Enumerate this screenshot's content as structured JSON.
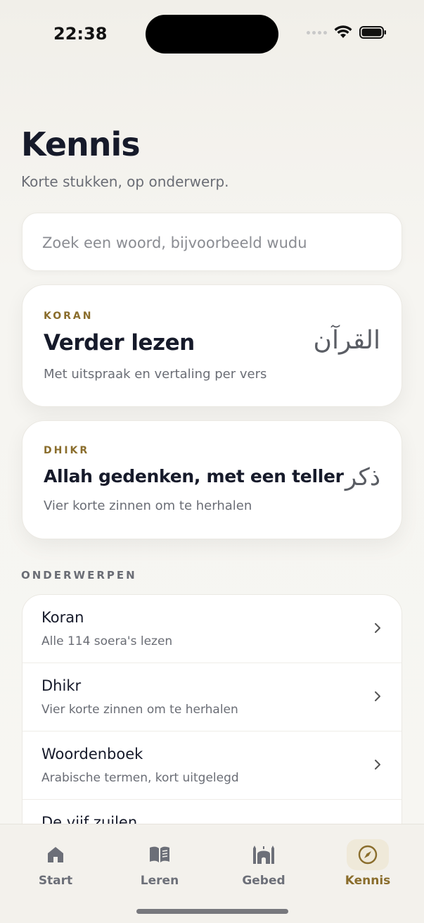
{
  "status_bar": {
    "time": "22:38"
  },
  "header": {
    "title": "Kennis",
    "subtitle": "Korte stukken, op onderwerp."
  },
  "search": {
    "placeholder": "Zoek een woord, bijvoorbeeld wudu",
    "value": ""
  },
  "featured": [
    {
      "eyebrow": "KORAN",
      "title": "Verder lezen",
      "description": "Met uitspraak en vertaling per vers",
      "arabic": "القرآن"
    },
    {
      "eyebrow": "DHIKR",
      "title": "Allah gedenken, met een teller",
      "description": "Vier korte zinnen om te herhalen",
      "arabic": "ذكر"
    }
  ],
  "topics": {
    "section_label": "ONDERWERPEN",
    "items": [
      {
        "title": "Koran",
        "subtitle": "Alle 114 soera's lezen"
      },
      {
        "title": "Dhikr",
        "subtitle": "Vier korte zinnen om te herhalen"
      },
      {
        "title": "Woordenboek",
        "subtitle": "Arabische termen, kort uitgelegd"
      },
      {
        "title": "De vijf zuilen",
        "subtitle": ""
      }
    ]
  },
  "tab_bar": {
    "active": "Kennis",
    "items": [
      {
        "label": "Start",
        "icon": "home-icon"
      },
      {
        "label": "Leren",
        "icon": "book-icon"
      },
      {
        "label": "Gebed",
        "icon": "mosque-icon"
      },
      {
        "label": "Kennis",
        "icon": "compass-icon"
      }
    ]
  },
  "colors": {
    "accent": "#8a6d2c",
    "accent_bg": "#efe9d9",
    "title": "#161a2a",
    "muted": "#6a6d75"
  }
}
